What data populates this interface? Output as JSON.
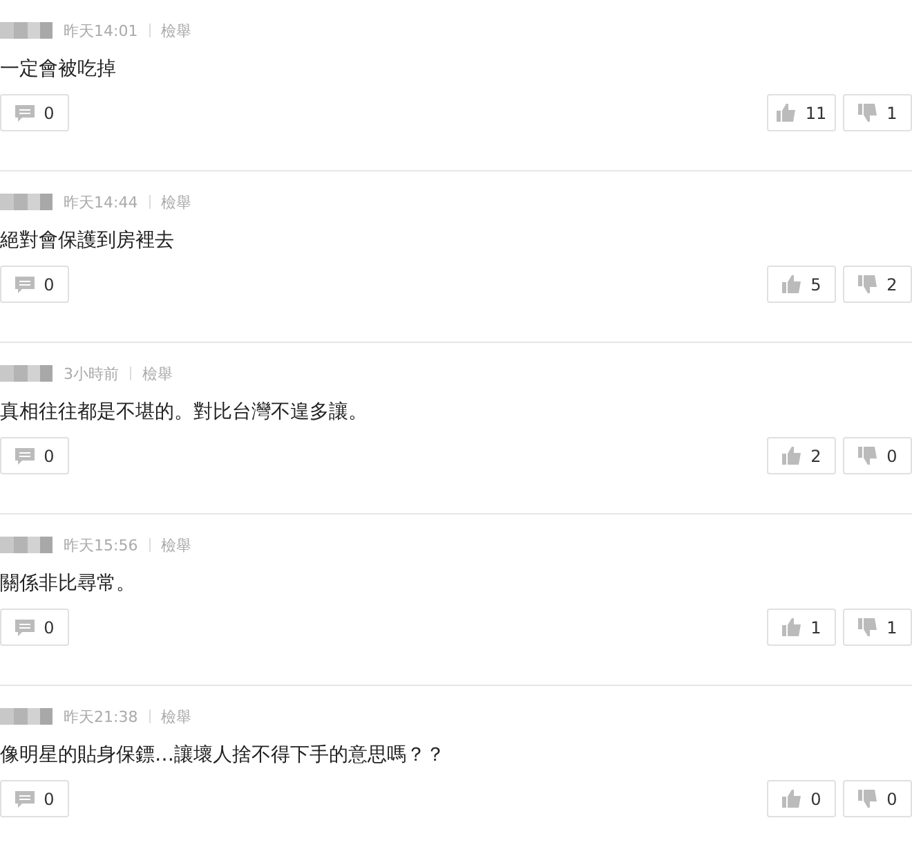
{
  "comments": [
    {
      "time": "昨天14:01",
      "report": "檢舉",
      "text": "一定會被吃掉",
      "replies": "0",
      "likes": "11",
      "dislikes": "1"
    },
    {
      "time": "昨天14:44",
      "report": "檢舉",
      "text": "絕對會保護到房裡去",
      "replies": "0",
      "likes": "5",
      "dislikes": "2"
    },
    {
      "time": "3小時前",
      "report": "檢舉",
      "text": "真相往往都是不堪的。對比台灣不遑多讓。",
      "replies": "0",
      "likes": "2",
      "dislikes": "0"
    },
    {
      "time": "昨天15:56",
      "report": "檢舉",
      "text": "關係非比尋常。",
      "replies": "0",
      "likes": "1",
      "dislikes": "1"
    },
    {
      "time": "昨天21:38",
      "report": "檢舉",
      "text": "像明星的貼身保鏢…讓壞人捨不得下手的意思嗎？？",
      "replies": "0",
      "likes": "0",
      "dislikes": "0"
    }
  ]
}
